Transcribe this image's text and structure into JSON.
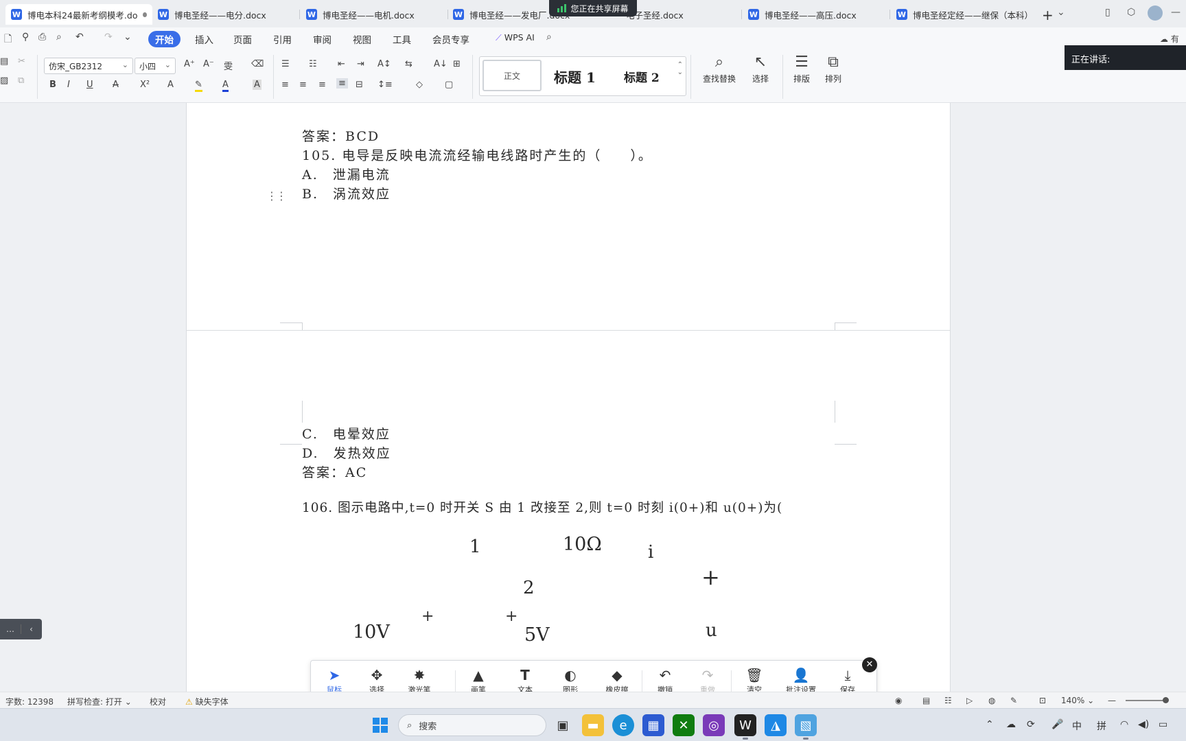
{
  "tabs": [
    {
      "label": "博电本科24最新考纲模考.do",
      "active": true
    },
    {
      "label": "博电圣经——电分.docx"
    },
    {
      "label": "博电圣经——电机.docx"
    },
    {
      "label": "博电圣经——发电厂.docx"
    },
    {
      "label": "电子圣经.docx"
    },
    {
      "label": "博电圣经——高压.docx"
    },
    {
      "label": "博电圣经定经——继保（本科）"
    }
  ],
  "share_banner": "您正在共享屏幕",
  "menu": {
    "items": [
      "开始",
      "插入",
      "页面",
      "引用",
      "审阅",
      "视图",
      "工具",
      "会员专享"
    ],
    "active": "开始",
    "wps_ai": "WPS AI",
    "right_label": "有修"
  },
  "ribbon": {
    "font_name": "仿宋_GB2312",
    "font_size": "小四",
    "styles": {
      "normal": "正文",
      "h1": "标题 1",
      "h2": "标题 2"
    },
    "find_replace": "查找替换",
    "select": "选择",
    "layout": "排版",
    "arrange": "排列"
  },
  "speaking": "正在讲话:",
  "document": {
    "page1_lines": [
      "答案：BCD",
      "105. 电导是反映电流流经输电线路时产生的（　　）。",
      "A.　泄漏电流",
      "B.　涡流效应"
    ],
    "page2_lines": [
      "C.　电晕效应",
      "D.　发热效应",
      "答案：AC",
      "106. 图示电路中,t=0 时开关 S 由 1 改接至 2,则 t=0 时刻 i(0+)和 u(0+)为("
    ],
    "circuit": {
      "node1": "1",
      "node2": "2",
      "resistor": "10Ω",
      "current": "i",
      "plus_out": "+",
      "voltage": "u",
      "src1": "10V",
      "src2": "5V",
      "plus1": "+",
      "plus2": "+"
    }
  },
  "annotation_toolbar": {
    "tools": [
      {
        "label": "鼠标",
        "icon": "cursor-icon",
        "active": true
      },
      {
        "label": "选择",
        "icon": "move-icon"
      },
      {
        "label": "激光笔",
        "icon": "laser-icon"
      },
      {
        "label": "画笔",
        "icon": "pen-icon"
      },
      {
        "label": "文本",
        "icon": "text-icon"
      },
      {
        "label": "图形",
        "icon": "shape-icon"
      },
      {
        "label": "橡皮擦",
        "icon": "eraser-icon"
      },
      {
        "label": "撤销",
        "icon": "undo-icon"
      },
      {
        "label": "重做",
        "icon": "redo-icon",
        "disabled": true
      },
      {
        "label": "清空",
        "icon": "trash-icon"
      },
      {
        "label": "批注设置",
        "icon": "settings-user-icon"
      },
      {
        "label": "保存",
        "icon": "download-icon"
      }
    ]
  },
  "statusbar": {
    "word_count": "字数: 12398",
    "spell_check": "拼写检查: 打开",
    "proofread": "校对",
    "missing_font": "缺失字体",
    "zoom": "140%"
  },
  "taskbar": {
    "search": "搜索",
    "ime_lang": "中",
    "ime_mode": "拼"
  }
}
